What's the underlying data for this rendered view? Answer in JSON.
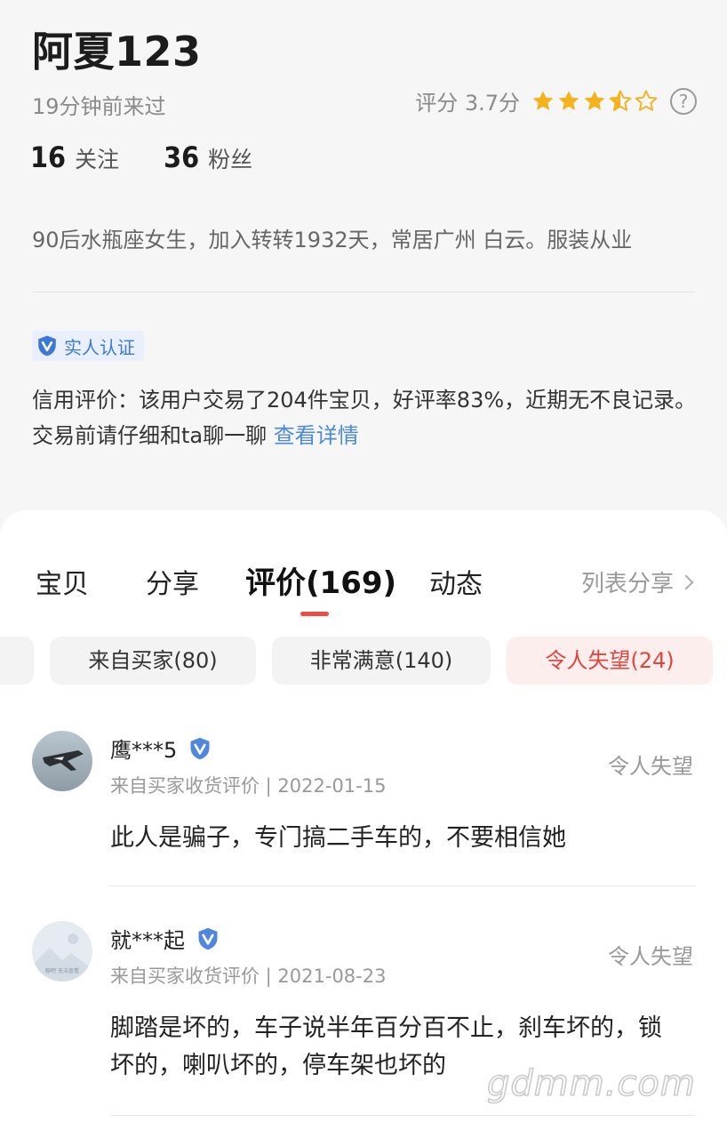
{
  "profile": {
    "username": "阿夏123",
    "last_seen": "19分钟前来过",
    "rating_text": "评分 3.7分",
    "rating_value": 3.7,
    "rating_max": 5,
    "follow_count": "16",
    "follow_label": "关注",
    "fans_count": "36",
    "fans_label": "粉丝",
    "bio": "90后水瓶座女生，加入转转1932天，常居广州 白云。服装从业",
    "verify_label": "实人认证",
    "credit_text": "信用评价：该用户交易了204件宝贝，好评率83%，近期无不良记录。交易前请仔细和ta聊一聊 ",
    "credit_link": "查看详情"
  },
  "tabs": [
    {
      "label": "宝贝"
    },
    {
      "label": "分享"
    },
    {
      "label": "评价(169)"
    },
    {
      "label": "动态"
    }
  ],
  "list_share_label": "列表分享",
  "filters": [
    {
      "label": "来自买家(80)"
    },
    {
      "label": "非常满意(140)"
    },
    {
      "label": "令人失望(24)"
    }
  ],
  "reviews": [
    {
      "name": "鹰***5",
      "meta": "来自买家收货评价 | 2022-01-15",
      "tag": "令人失望",
      "text": "此人是骗子，专门搞二手车的，不要相信她"
    },
    {
      "name": "就***起",
      "meta": "来自买家收货评价 | 2021-08-23",
      "tag": "令人失望",
      "text": "脚踏是坏的，车子说半年百分百不止，刹车坏的，锁坏的，喇叭坏的，停车架也坏的",
      "avatar_caption": "聊吧 无法查看"
    }
  ],
  "watermark": "gdmm.com",
  "colors": {
    "accent": "#ef4c44",
    "star": "#f5b21d",
    "link": "#4a8ad9",
    "verify": "#3c78d8"
  }
}
